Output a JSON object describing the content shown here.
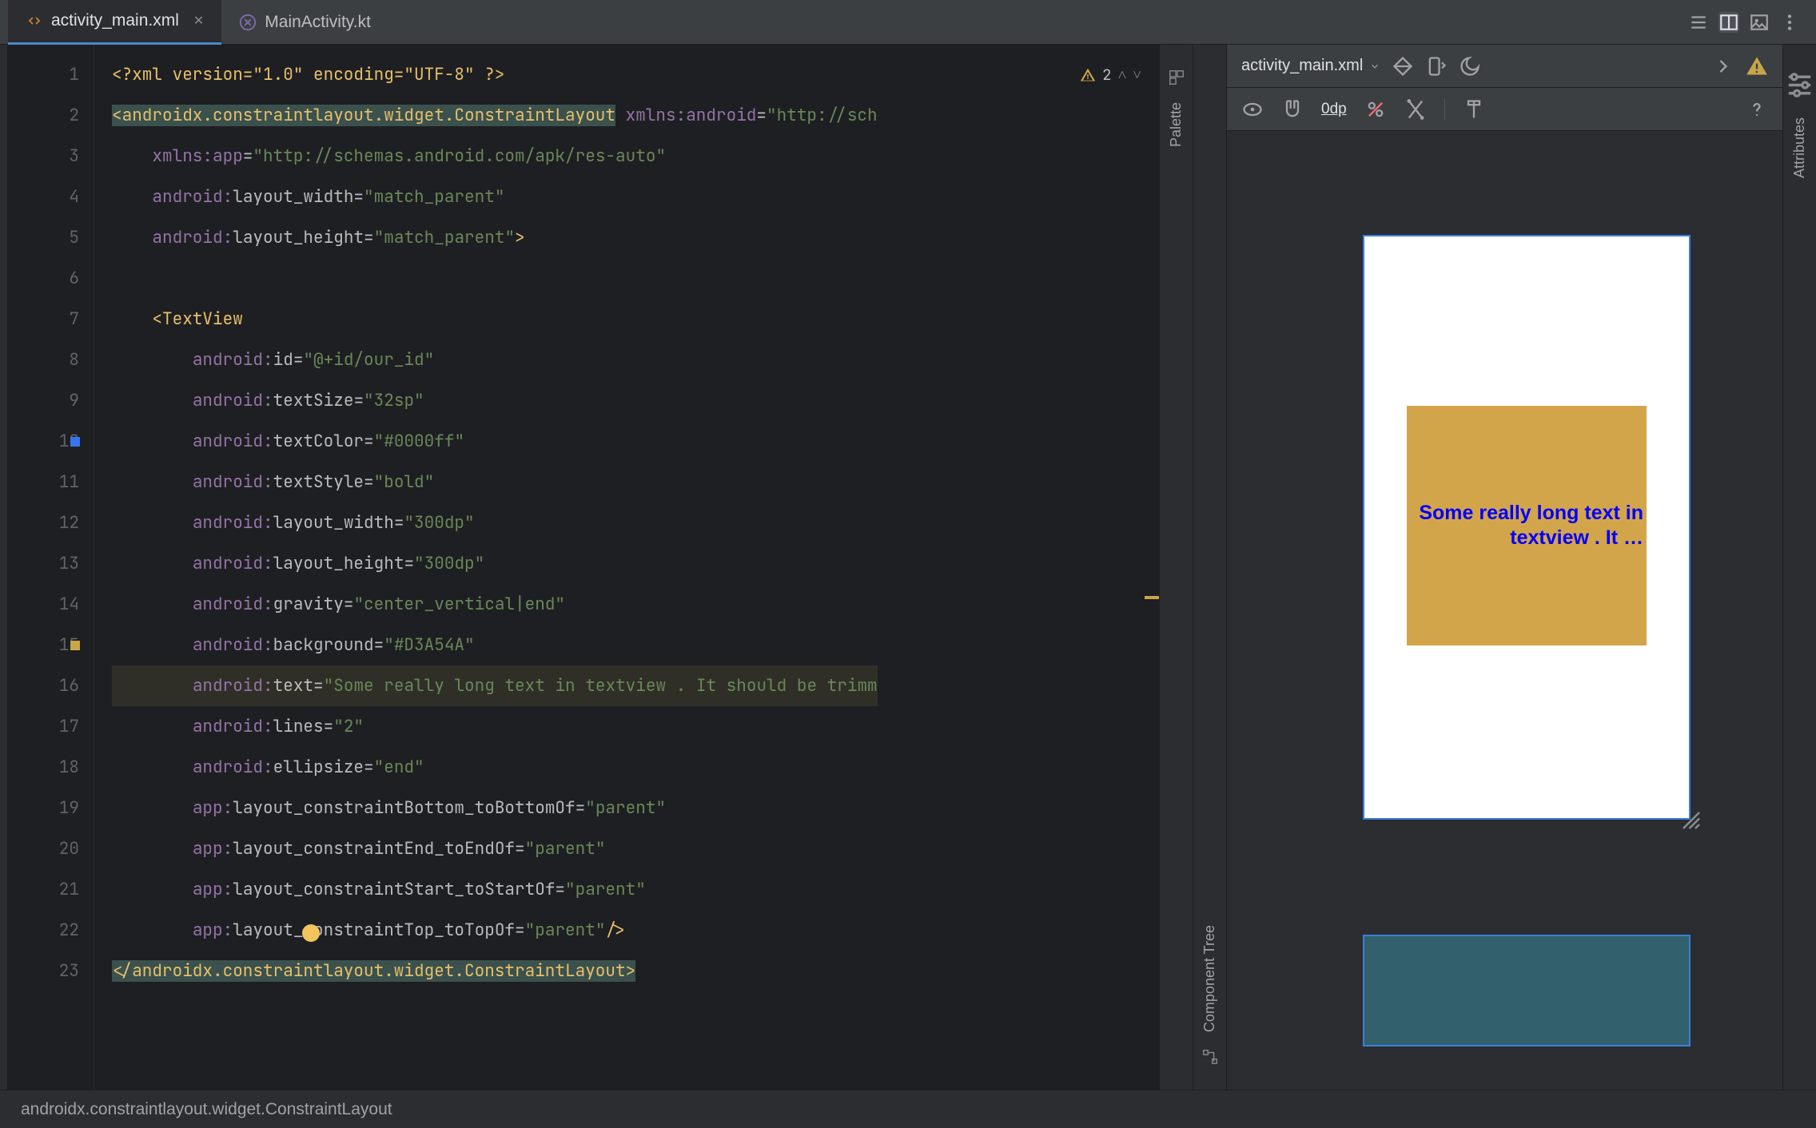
{
  "tabs": {
    "active": "activity_main.xml",
    "inactive": "MainActivity.kt"
  },
  "topright_icons": [
    "list-icon",
    "split-icon",
    "design-icon",
    "more-icon"
  ],
  "editor": {
    "warn_count": "2",
    "lines": [
      {
        "n": "1"
      },
      {
        "n": "2"
      },
      {
        "n": "3"
      },
      {
        "n": "4"
      },
      {
        "n": "5"
      },
      {
        "n": "6"
      },
      {
        "n": "7"
      },
      {
        "n": "8"
      },
      {
        "n": "9"
      },
      {
        "n": "10"
      },
      {
        "n": "11"
      },
      {
        "n": "12"
      },
      {
        "n": "13"
      },
      {
        "n": "14"
      },
      {
        "n": "15"
      },
      {
        "n": "16"
      },
      {
        "n": "17"
      },
      {
        "n": "18"
      },
      {
        "n": "19"
      },
      {
        "n": "20"
      },
      {
        "n": "21"
      },
      {
        "n": "22"
      },
      {
        "n": "23"
      }
    ],
    "tokens": {
      "l1_decl": "<?xml version=\"1.0\" encoding=\"UTF-8\" ?>",
      "l2_open": "<androidx.constraintlayout.widget.ConstraintLayout",
      "l2_ns": " xmlns:android",
      "l2_eq": "=",
      "l2_val": "\"http://sch",
      "l3_ns": "xmlns:app",
      "l3_val": "\"http://schemas.android.com/apk/res-auto\"",
      "l4_a": "android:",
      "l4_b": "layout_width",
      "l4_v": "\"match_parent\"",
      "l5_a": "android:",
      "l5_b": "layout_height",
      "l5_v": "\"match_parent\"",
      "l5_end": ">",
      "l7_tag": "<TextView",
      "l8_a": "android:",
      "l8_b": "id",
      "l8_v": "\"@+id/our_id\"",
      "l9_a": "android:",
      "l9_b": "textSize",
      "l9_v": "\"32sp\"",
      "l10_a": "android:",
      "l10_b": "textColor",
      "l10_v": "\"#0000ff\"",
      "l11_a": "android:",
      "l11_b": "textStyle",
      "l11_v": "\"bold\"",
      "l12_a": "android:",
      "l12_b": "layout_width",
      "l12_v": "\"300dp\"",
      "l13_a": "android:",
      "l13_b": "layout_height",
      "l13_v": "\"300dp\"",
      "l14_a": "android:",
      "l14_b": "gravity",
      "l14_v": "\"center_vertical|end\"",
      "l15_a": "android:",
      "l15_b": "background",
      "l15_v": "\"#D3A54A\"",
      "l16_a": "android:",
      "l16_b": "text",
      "l16_v": "\"Some really long text in textview . It should be trimm",
      "l17_a": "android:",
      "l17_b": "lines",
      "l17_v": "\"2\"",
      "l18_a": "android:",
      "l18_b": "ellipsize",
      "l18_v": "\"end\"",
      "l19_a": "app:",
      "l19_b": "layout_constraintBottom_toBottomOf",
      "l19_v": "\"parent\"",
      "l20_a": "app:",
      "l20_b": "layout_constraintEnd_toEndOf",
      "l20_v": "\"parent\"",
      "l21_a": "app:",
      "l21_b": "layout_constraintStart_toStartOf",
      "l21_v": "\"parent\"",
      "l22_a": "app:",
      "l22_b": "layout_constraintTop_toTopOf",
      "l22_v": "\"parent\"",
      "l22_end": "/>",
      "l23_close": "</androidx.constraintlayout.widget.ConstraintLayout>"
    }
  },
  "side_labels": {
    "palette": "Palette",
    "component_tree": "Component Tree",
    "attributes": "Attributes"
  },
  "design": {
    "file": "activity_main.xml",
    "zero": "0dp",
    "preview_text": "Some really long text in textview . It …"
  },
  "breadcrumb": "androidx.constraintlayout.widget.ConstraintLayout"
}
